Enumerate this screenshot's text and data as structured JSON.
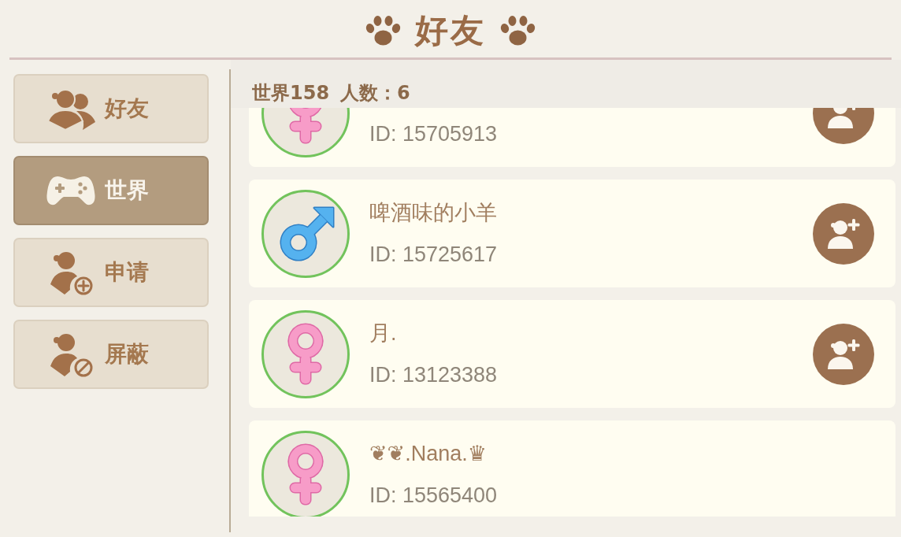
{
  "title": "好友",
  "sidebar": {
    "items": [
      {
        "kind": "friends",
        "label": "好友",
        "selected": false
      },
      {
        "kind": "world",
        "label": "世界",
        "selected": true
      },
      {
        "kind": "requests",
        "label": "申请",
        "selected": false
      },
      {
        "kind": "blocked",
        "label": "屏蔽",
        "selected": false
      }
    ]
  },
  "list_header": {
    "room": "世界158",
    "count": "人数：6"
  },
  "players": [
    {
      "kind": "female",
      "id": "ID: 15705913",
      "can_add": true
    },
    {
      "kind": "male",
      "name": "啤酒味的小羊",
      "id": "ID: 15725617",
      "can_add": true
    },
    {
      "kind": "female",
      "name": "月.",
      "id": "ID: 13123388",
      "can_add": true
    },
    {
      "kind": "female",
      "name": "❦❦.Nana.♛",
      "id": "ID: 15565400",
      "can_add": false
    }
  ]
}
